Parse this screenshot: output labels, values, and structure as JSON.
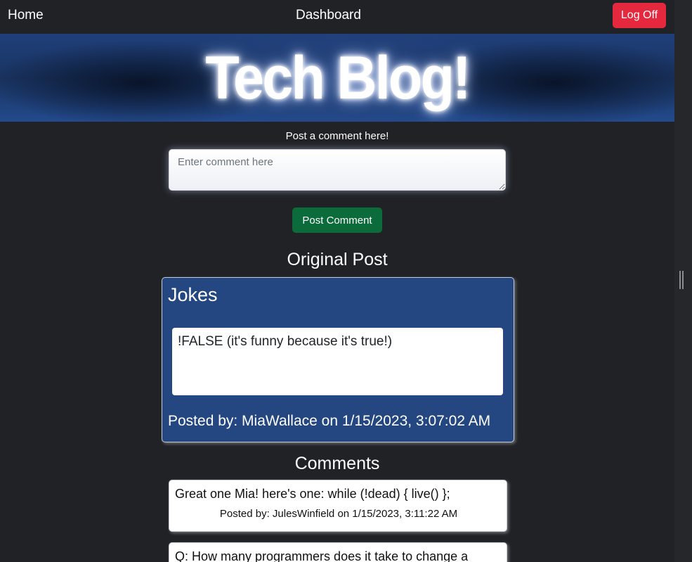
{
  "nav": {
    "home_label": "Home",
    "dashboard_label": "Dashboard",
    "logoff_label": "Log Off"
  },
  "banner": {
    "title": "Tech Blog!"
  },
  "comment_form": {
    "prompt": "Post a comment here!",
    "placeholder": "Enter comment here",
    "value": "",
    "submit_label": "Post Comment"
  },
  "original_post": {
    "heading": "Original Post",
    "title": "Jokes",
    "body": "!FALSE (it's funny because it's true!)",
    "meta": "Posted by: MiaWallace on 1/15/2023, 3:07:02 AM"
  },
  "comments": {
    "heading": "Comments",
    "items": [
      {
        "text": "Great one Mia! here's one: while (!dead) { live() };",
        "meta": "Posted by: JulesWinfield on 1/15/2023, 3:11:22 AM"
      },
      {
        "text": "Q: How many programmers does it take to change a",
        "meta": ""
      }
    ]
  },
  "colors": {
    "page_background": "#212226",
    "banner_blue": "#1f3f7a",
    "post_card_blue": "#244781",
    "logoff_red": "#e5283d",
    "post_comment_green": "#0b6b3a"
  }
}
